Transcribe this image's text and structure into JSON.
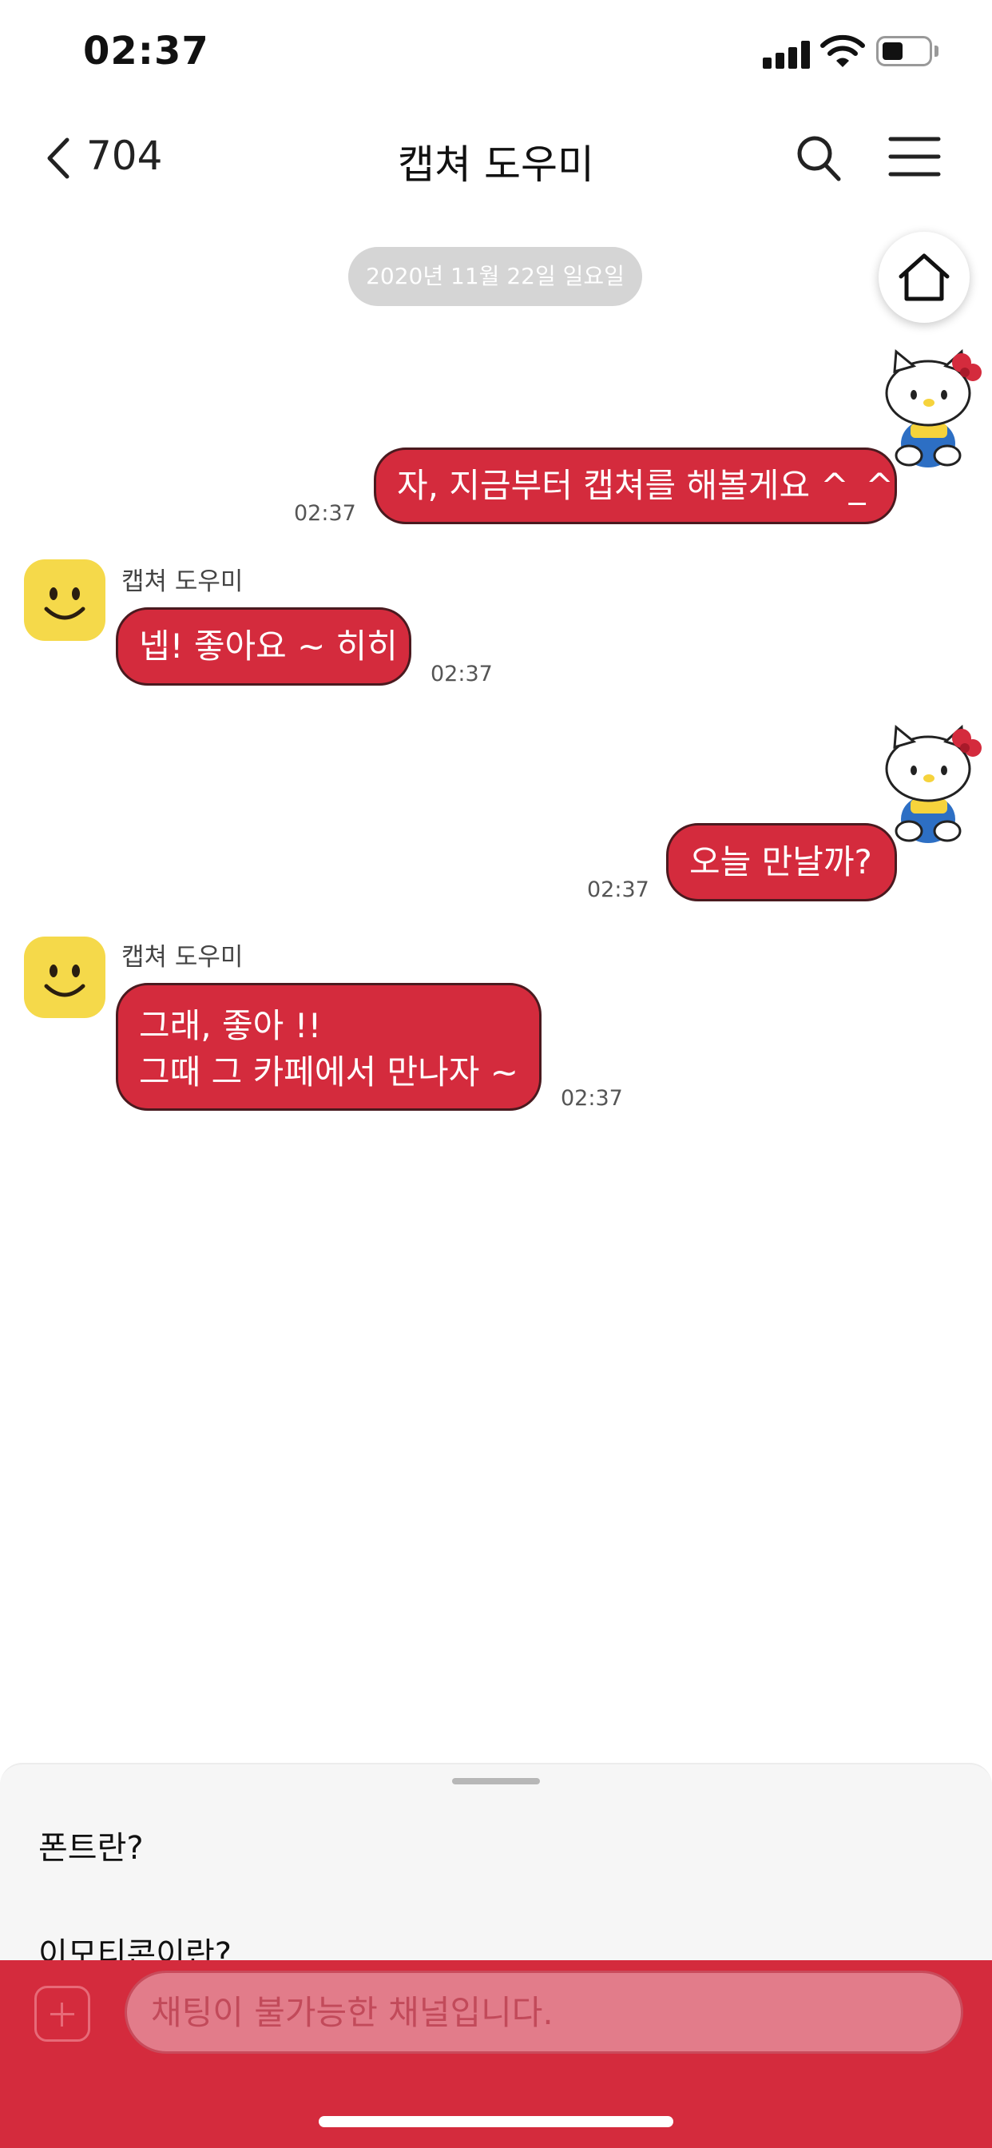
{
  "status_bar": {
    "time": "02:37"
  },
  "nav": {
    "back_count": "704",
    "title": "캡쳐 도우미"
  },
  "date_divider": "2020년 11월 22일 일요일",
  "messages": [
    {
      "side": "right",
      "text": "자, 지금부터 캡쳐를 해볼게요 ^_^",
      "time": "02:37"
    },
    {
      "side": "left",
      "sender": "캡쳐 도우미",
      "text": "넵! 좋아요 ~ 히히",
      "time": "02:37"
    },
    {
      "side": "right",
      "text": "오늘 만날까?",
      "time": "02:37"
    },
    {
      "side": "left",
      "sender": "캡쳐 도우미",
      "text": "그래, 좋아 !!\n그때 그 카페에서 만나자 ~",
      "time": "02:37"
    }
  ],
  "suggestions": [
    "폰트란?",
    "이모티콘이란?"
  ],
  "input": {
    "placeholder": "채팅이 불가능한 채널입니다."
  },
  "colors": {
    "accent": "#d42b3d",
    "date_pill": "#d5d5d5",
    "avatar": "#f5d94a"
  },
  "icons": [
    "back-icon",
    "search-icon",
    "menu-icon",
    "home-icon",
    "plus-icon",
    "smiley-avatar-icon",
    "kitty-sticker"
  ]
}
